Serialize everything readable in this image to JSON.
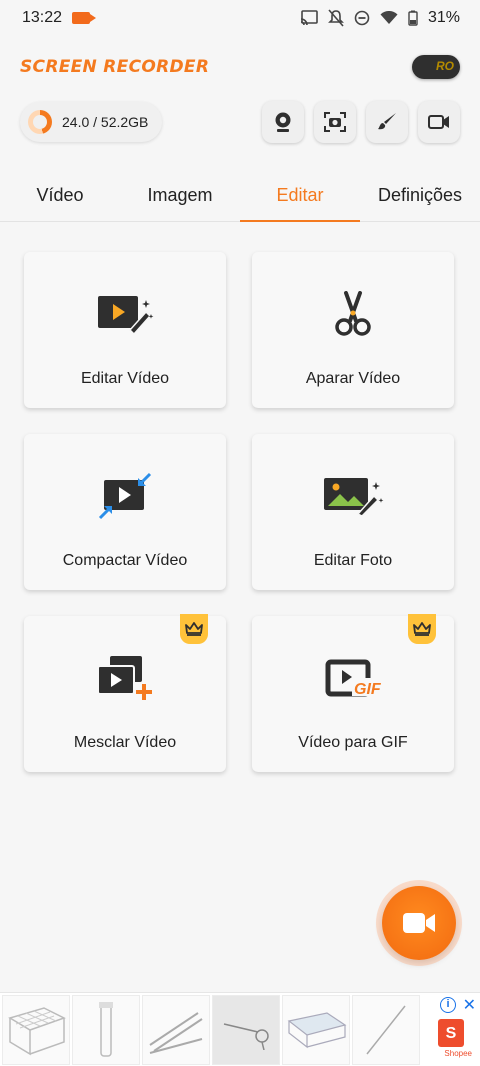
{
  "status_bar": {
    "time": "13:22",
    "battery": "31%",
    "icons": [
      "screen-record-icon",
      "cast-icon",
      "mute-icon",
      "dnd-icon",
      "wifi-icon",
      "battery-icon"
    ]
  },
  "header": {
    "logo": "SCREEN RECORDER",
    "pro_badge": "RO"
  },
  "storage": {
    "text": "24.0 / 52.2GB",
    "used_fraction": 0.46
  },
  "quick_actions": [
    "webcam-icon",
    "screenshot-icon",
    "brush-icon",
    "video-camera-icon"
  ],
  "tabs": [
    {
      "label": "Vídeo",
      "active": false
    },
    {
      "label": "Imagem",
      "active": false
    },
    {
      "label": "Editar",
      "active": true
    },
    {
      "label": "Definições",
      "active": false
    }
  ],
  "cards": [
    {
      "label": "Editar Vídeo",
      "icon": "edit-video-icon",
      "premium": false
    },
    {
      "label": "Aparar Vídeo",
      "icon": "scissors-icon",
      "premium": false
    },
    {
      "label": "Compactar Vídeo",
      "icon": "compress-video-icon",
      "premium": false
    },
    {
      "label": "Editar Foto",
      "icon": "edit-photo-icon",
      "premium": false
    },
    {
      "label": "Mesclar Vídeo",
      "icon": "merge-video-icon",
      "premium": true
    },
    {
      "label": "Vídeo para GIF",
      "icon": "video-to-gif-icon",
      "premium": true
    }
  ],
  "fab": {
    "icon": "record-video-icon"
  },
  "ad": {
    "brand": "Shopee",
    "icons": [
      "ad-info-icon",
      "ad-close-icon"
    ]
  },
  "colors": {
    "accent": "#f47a1f",
    "crown": "#ffc23a",
    "icon_dark": "#2f2f2f",
    "icon_blue": "#2b8ee8"
  }
}
